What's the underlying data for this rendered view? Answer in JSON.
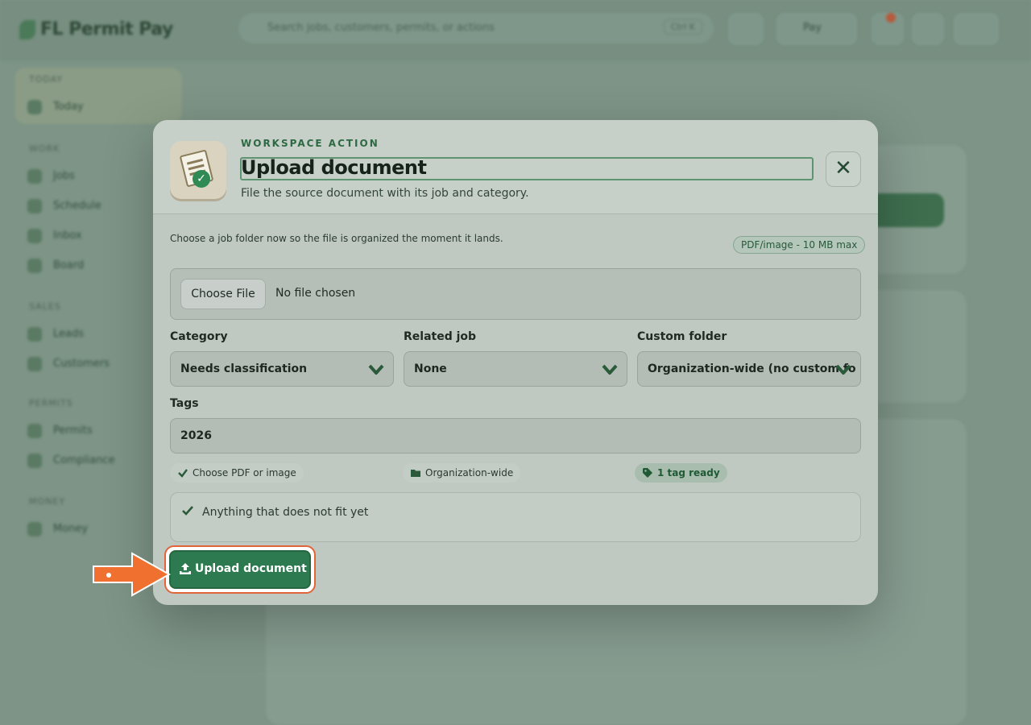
{
  "background": {
    "app_name": "FL Permit Pay",
    "search_placeholder": "Search jobs, customers, permits, or actions",
    "search_shortcut": "Ctrl K",
    "user_chip": "Pay",
    "sidebar": {
      "section_today": "TODAY",
      "item_today": "Today",
      "section_work": "WORK",
      "items_work": [
        "Jobs",
        "Schedule",
        "Inbox",
        "Board"
      ],
      "section_sales": "SALES",
      "items_sales": [
        "Leads",
        "Customers"
      ],
      "section_permits": "PERMITS",
      "items_permits": [
        "Permits",
        "Compliance"
      ],
      "section_money": "MONEY",
      "items_money": [
        "Money"
      ]
    },
    "colors": {
      "accent": "#2d7a50",
      "highlight": "#e2643a"
    }
  },
  "modal": {
    "eyebrow": "WORKSPACE ACTION",
    "title": "Upload document",
    "subtitle": "File the source document with its job and category.",
    "close_symbol": "✕",
    "hint": "Choose a job folder now so the file is organized the moment it lands.",
    "limit_badge": "PDF/image - 10 MB max",
    "file": {
      "choose_label": "Choose File",
      "status": "No file chosen"
    },
    "category": {
      "label": "Category",
      "value": "Needs classification"
    },
    "related_job": {
      "label": "Related job",
      "value": "None"
    },
    "custom_folder": {
      "label": "Custom folder",
      "value": "Organization-wide (no custom fo"
    },
    "tags": {
      "label": "Tags",
      "value": "2026"
    },
    "status_pills": {
      "file": "Choose PDF or image",
      "folder": "Organization-wide",
      "tags": "1 tag ready"
    },
    "category_note": "Anything that does not fit yet",
    "submit_label": "Upload document"
  }
}
